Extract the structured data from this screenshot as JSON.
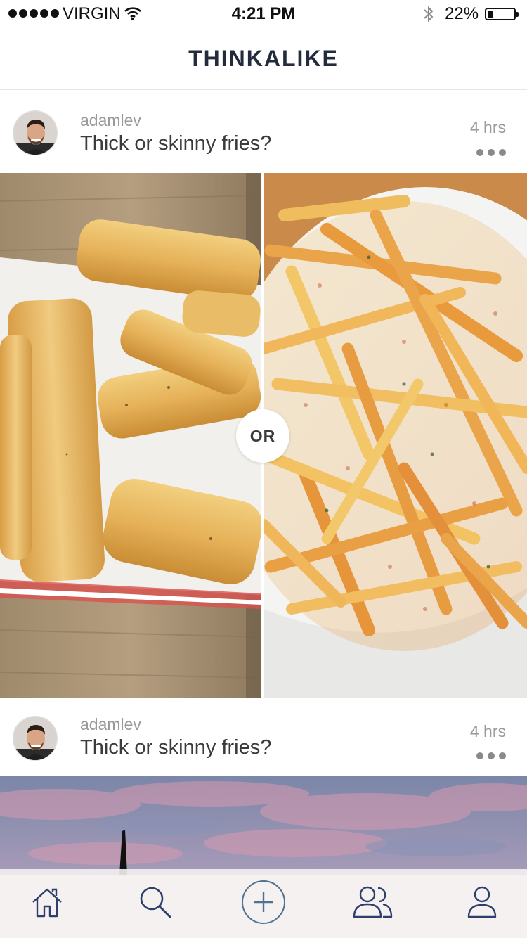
{
  "status_bar": {
    "carrier": "VIRGIN",
    "time": "4:21 PM",
    "battery_percent_label": "22%",
    "battery_level": 0.22,
    "signal_bars": 5
  },
  "nav": {
    "title": "THINKALIKE"
  },
  "posts": [
    {
      "username": "adamlev",
      "question": "Thick or skinny fries?",
      "time": "4 hrs",
      "separator": "OR"
    },
    {
      "username": "adamlev",
      "question": "Thick or skinny fries?",
      "time": "4 hrs"
    }
  ],
  "tab_bar": {
    "tabs": [
      {
        "icon": "home-icon"
      },
      {
        "icon": "search-icon"
      },
      {
        "icon": "add-icon"
      },
      {
        "icon": "friends-icon"
      },
      {
        "icon": "profile-icon"
      }
    ]
  },
  "colors": {
    "title": "#232b3c",
    "tab_icon": "#2f3f6b",
    "add_button": "#4f7290",
    "secondary_text": "#9a9a9a",
    "primary_text": "#3b3b3b"
  }
}
